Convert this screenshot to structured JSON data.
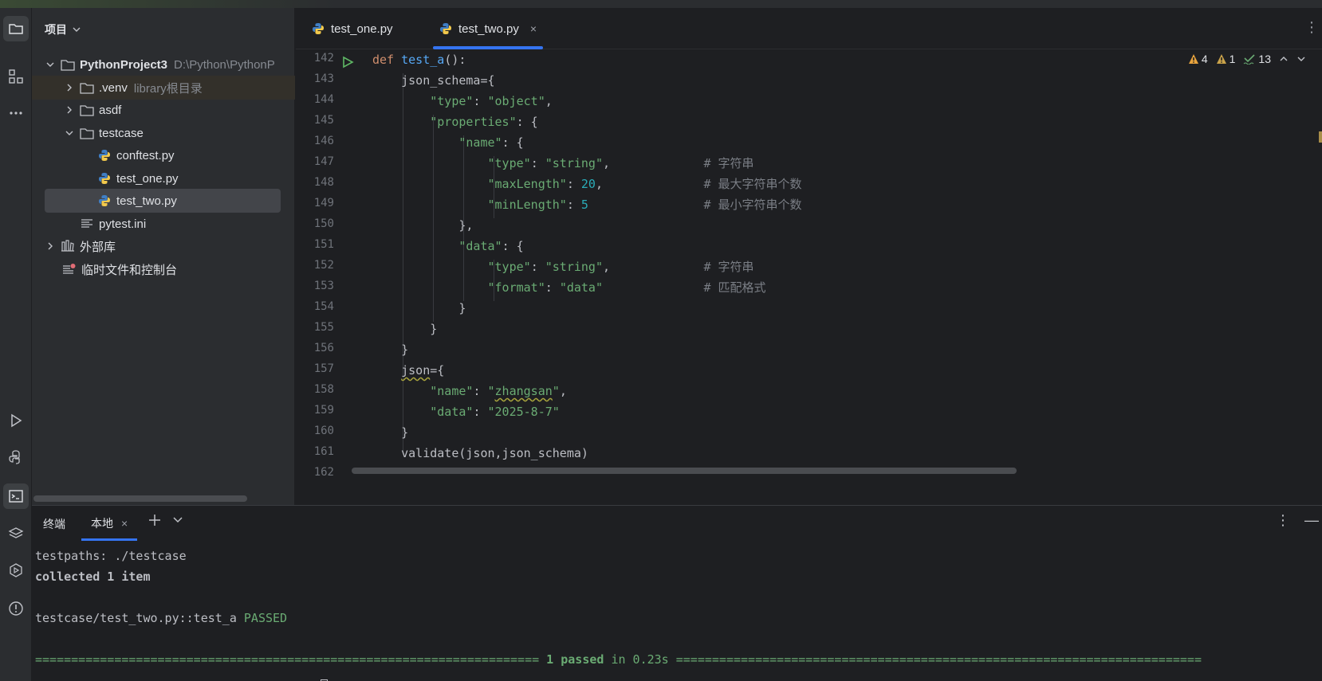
{
  "project_panel": {
    "title": "项目",
    "tree": [
      {
        "label": "PythonProject3",
        "hint": "D:\\Python\\PythonP"
      },
      {
        "label": ".venv",
        "hint": "library根目录"
      },
      {
        "label": "asdf"
      },
      {
        "label": "testcase"
      },
      {
        "label": "conftest.py"
      },
      {
        "label": "test_one.py"
      },
      {
        "label": "test_two.py"
      },
      {
        "label": "pytest.ini"
      },
      {
        "label": "外部库"
      },
      {
        "label": "临时文件和控制台"
      }
    ]
  },
  "editor": {
    "tabs": [
      {
        "label": "test_one.py"
      },
      {
        "label": "test_two.py",
        "close": "×"
      }
    ],
    "inspection": {
      "warnings": "4",
      "weak_warnings": "1",
      "ok": "13"
    },
    "line_numbers": [
      "142",
      "143",
      "144",
      "145",
      "146",
      "147",
      "148",
      "149",
      "150",
      "151",
      "152",
      "153",
      "154",
      "155",
      "156",
      "157",
      "158",
      "159",
      "160",
      "161",
      "162"
    ],
    "code": {
      "l142": {
        "kw": "def",
        "fn": "test_a",
        "rest": "():"
      },
      "l143": "json_schema={",
      "l144": {
        "k": "\"type\"",
        "v": "\"object\""
      },
      "l145": {
        "k": "\"properties\"",
        "rest": ": {"
      },
      "l146": {
        "k": "\"name\"",
        "rest": ": {"
      },
      "l147": {
        "k": "\"type\"",
        "v": "\"string\"",
        "cmt": "# 字符串"
      },
      "l148": {
        "k": "\"maxLength\"",
        "v": "20",
        "cmt": "# 最大字符串个数"
      },
      "l149": {
        "k": "\"minLength\"",
        "v": "5",
        "cmt": "# 最小字符串个数"
      },
      "l150": "},",
      "l151": {
        "k": "\"data\"",
        "rest": ": {"
      },
      "l152": {
        "k": "\"type\"",
        "v": "\"string\"",
        "cmt": "# 字符串"
      },
      "l153": {
        "k": "\"format\"",
        "v": "\"data\"",
        "cmt": "# 匹配格式"
      },
      "l154": "}",
      "l155": "}",
      "l156": "}",
      "l157": {
        "name": "json",
        "rest": "={"
      },
      "l158": {
        "k": "\"name\"",
        "v_q1": "\"",
        "v_word": "zhangsan",
        "v_q2": "\""
      },
      "l159": {
        "k": "\"data\"",
        "v": "\"2025-8-7\""
      },
      "l160": "}",
      "l161": "validate(json,json_schema)"
    }
  },
  "terminal": {
    "title": "终端",
    "tab": "本地",
    "lines": {
      "testpaths": "testpaths: ./testcase",
      "collected": "collected 1 item",
      "result_path": "testcase/test_two.py::test_a ",
      "result_status": "PASSED",
      "summary_left": "======================================================================",
      "summary_mid": " 1 passed ",
      "summary_in": "in 0.23s",
      "summary_right": " ========================================================================="
    }
  },
  "colors": {
    "accent": "#3574f0",
    "keyword": "#cf8e6d",
    "function": "#56a8f5",
    "string": "#6aab73",
    "number": "#2aacb8",
    "comment": "#7a7e85",
    "warning": "#e8a33d"
  },
  "icons": [
    "folder-icon",
    "structure-icon",
    "more-icon",
    "run-icon",
    "python-console-icon",
    "terminal-icon",
    "layers-icon",
    "services-icon",
    "problems-icon",
    "python-file-icon",
    "text-file-icon",
    "library-icon",
    "scratch-icon"
  ]
}
